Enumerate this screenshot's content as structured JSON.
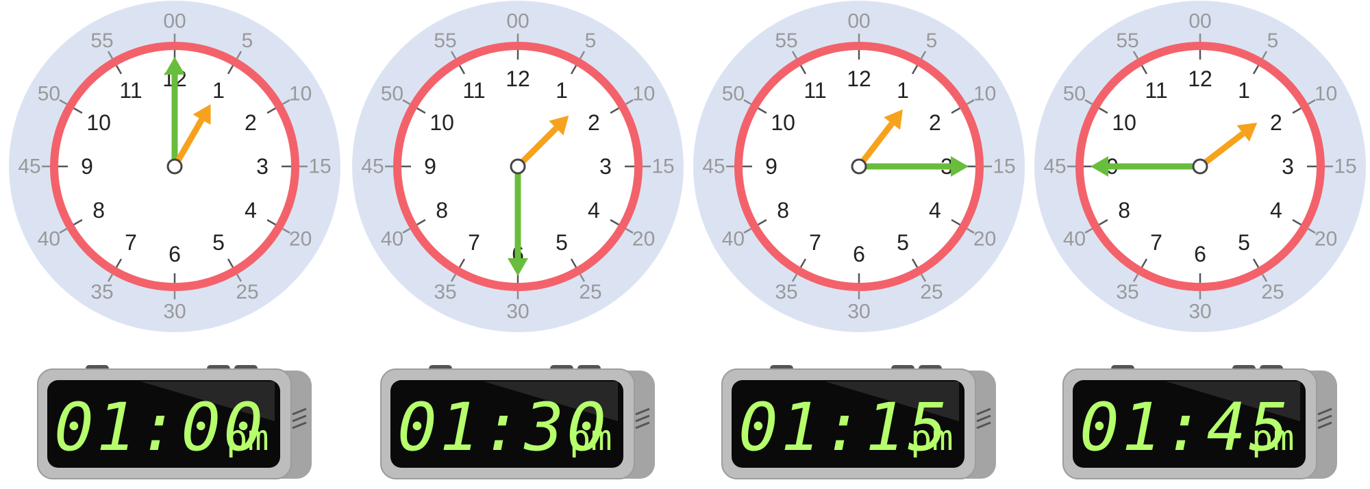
{
  "clocks": [
    {
      "minute_labels": [
        "00",
        "5",
        "10",
        "15",
        "20",
        "25",
        "30",
        "35",
        "40",
        "45",
        "50",
        "55"
      ],
      "hour_labels": [
        "12",
        "1",
        "2",
        "3",
        "4",
        "5",
        "6",
        "7",
        "8",
        "9",
        "10",
        "11"
      ],
      "hour_hand_points_to": 1,
      "minute_hand_points_to": 0,
      "digital": {
        "time": "01:00",
        "ampm": "pm"
      }
    },
    {
      "minute_labels": [
        "00",
        "5",
        "10",
        "15",
        "20",
        "25",
        "30",
        "35",
        "40",
        "45",
        "50",
        "55"
      ],
      "hour_labels": [
        "12",
        "1",
        "2",
        "3",
        "4",
        "5",
        "6",
        "7",
        "8",
        "9",
        "10",
        "11"
      ],
      "hour_hand_points_to": 1.5,
      "minute_hand_points_to": 30,
      "digital": {
        "time": "01:30",
        "ampm": "pm"
      }
    },
    {
      "minute_labels": [
        "00",
        "5",
        "10",
        "15",
        "20",
        "25",
        "30",
        "35",
        "40",
        "45",
        "50",
        "55"
      ],
      "hour_labels": [
        "12",
        "1",
        "2",
        "3",
        "4",
        "5",
        "6",
        "7",
        "8",
        "9",
        "10",
        "11"
      ],
      "hour_hand_points_to": 1.25,
      "minute_hand_points_to": 15,
      "digital": {
        "time": "01:15",
        "ampm": "pm"
      }
    },
    {
      "minute_labels": [
        "00",
        "5",
        "10",
        "15",
        "20",
        "25",
        "30",
        "35",
        "40",
        "45",
        "50",
        "55"
      ],
      "hour_labels": [
        "12",
        "1",
        "2",
        "3",
        "4",
        "5",
        "6",
        "7",
        "8",
        "9",
        "10",
        "11"
      ],
      "hour_hand_points_to": 1.75,
      "minute_hand_points_to": 45,
      "digital": {
        "time": "01:45",
        "ampm": "pm"
      }
    }
  ],
  "colors": {
    "outer_ring": "#dbe3f3",
    "bezel": "#f3626a",
    "face": "#ffffff",
    "hour_hand": "#f7a21c",
    "minute_hand": "#69bd3c",
    "minute_label": "#999999",
    "hour_label": "#222222",
    "lcd_background": "#0a0a0a",
    "lcd_digits": "#b6ff6c",
    "device_body": "#bdbdbd"
  }
}
